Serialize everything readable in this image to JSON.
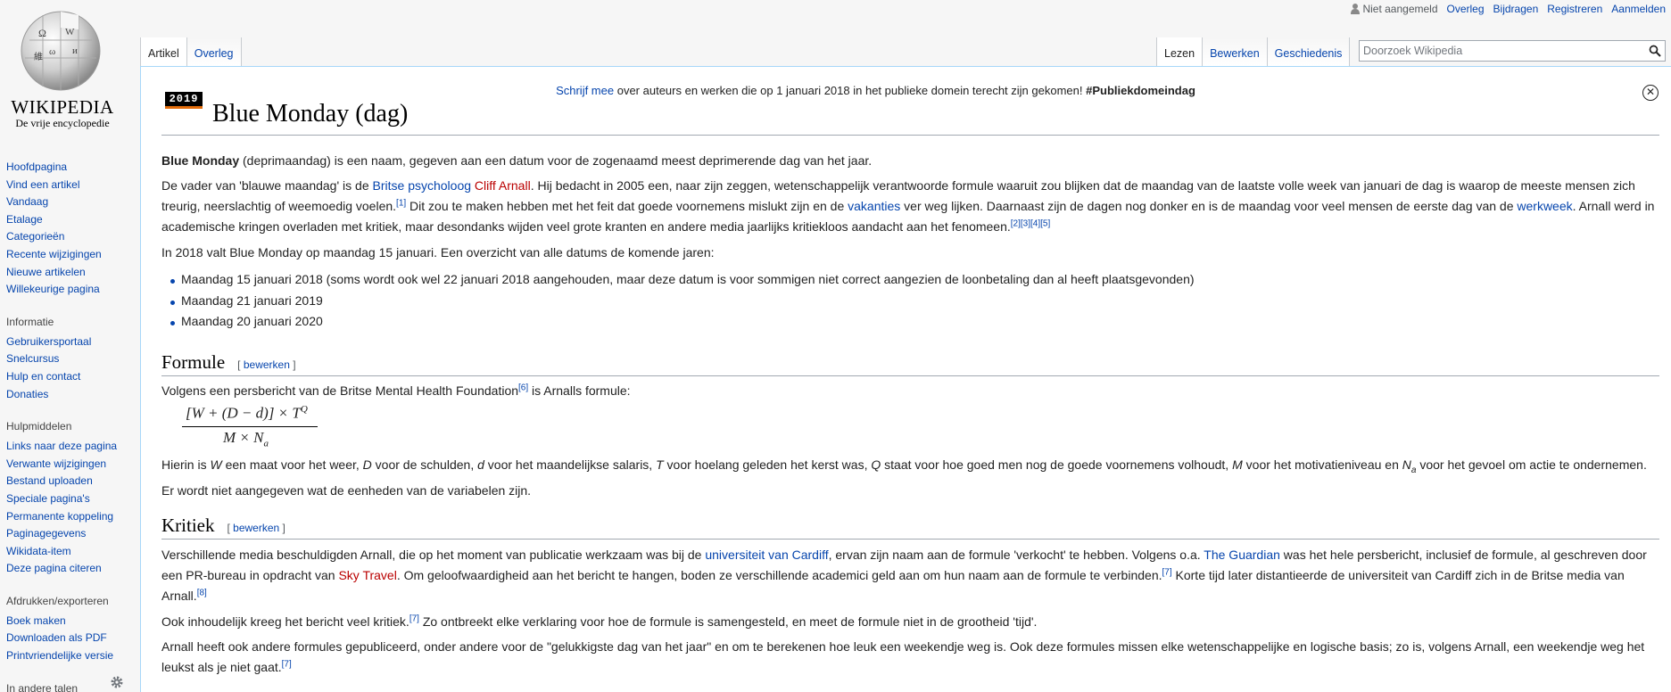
{
  "logo": {
    "wordmark": "Wikipedia",
    "tagline": "De vrije encyclopedie"
  },
  "personal": {
    "anon": "Niet aangemeld",
    "links": [
      "Overleg",
      "Bijdragen",
      "Registreren",
      "Aanmelden"
    ]
  },
  "tabs_left": [
    "Artikel",
    "Overleg"
  ],
  "tabs_right": [
    "Lezen",
    "Bewerken",
    "Geschiedenis"
  ],
  "search": {
    "placeholder": "Doorzoek Wikipedia"
  },
  "sidebar": {
    "nav": [
      "Hoofdpagina",
      "Vind een artikel",
      "Vandaag",
      "Etalage",
      "Categorieën",
      "Recente wijzigingen",
      "Nieuwe artikelen",
      "Willekeurige pagina"
    ],
    "info_heading": "Informatie",
    "info": [
      "Gebruikersportaal",
      "Snelcursus",
      "Hulp en contact",
      "Donaties"
    ],
    "tools_heading": "Hulpmiddelen",
    "tools": [
      "Links naar deze pagina",
      "Verwante wijzigingen",
      "Bestand uploaden",
      "Speciale pagina's",
      "Permanente koppeling",
      "Paginagegevens",
      "Wikidata-item",
      "Deze pagina citeren"
    ],
    "print_heading": "Afdrukken/exporteren",
    "print": [
      "Boek maken",
      "Downloaden als PDF",
      "Printvriendelijke versie"
    ],
    "lang_heading": "In andere talen"
  },
  "notice": {
    "link": "Schrijf mee",
    "text": " over auteurs en werken die op 1 januari 2018 in het publieke domein terecht zijn gekomen! ",
    "tag": "#Publiekdomeindag",
    "banner": "2019"
  },
  "article": {
    "title": "Blue Monday (dag)",
    "p1_bold": "Blue Monday",
    "p1_rest": " (deprimaandag) is een naam, gegeven aan een datum voor de zogenaamd meest deprimerende dag van het jaar.",
    "p2": {
      "a": "De vader van 'blauwe maandag' is de ",
      "l1": "Britse",
      "b": " ",
      "l2": "psycholoog",
      "c": " ",
      "l3": "Cliff Arnall",
      "d": ". Hij bedacht in 2005 een, naar zijn zeggen, wetenschappelijk verantwoorde formule waaruit zou blijken dat de maandag van de laatste volle week van januari de dag is waarop de meeste mensen zich treurig, neerslachtig of weemoedig voelen.",
      "r1": "[1]",
      "e": " Dit zou te maken hebben met het feit dat goede voornemens mislukt zijn en de ",
      "l4": "vakanties",
      "f": " ver weg lijken. Daarnaast zijn de dagen nog donker en is de maandag voor veel mensen de eerste dag van de ",
      "l5": "werkweek",
      "g": ". Arnall werd in academische kringen overladen met kritiek, maar desondanks wijden veel grote kranten en andere media jaarlijks kritiekloos aandacht aan het fenomeen.",
      "r2": "[2][3][4][5]"
    },
    "p3": "In 2018 valt Blue Monday op maandag 15 januari. Een overzicht van alle datums de komende jaren:",
    "days": [
      "Maandag 15 januari 2018 (soms wordt ook wel 22 januari 2018 aangehouden, maar deze datum is voor sommigen niet correct aangezien de loonbetaling dan al heeft plaatsgevonden)",
      "Maandag 21 januari 2019",
      "Maandag 20 januari 2020"
    ],
    "h_formule": "Formule",
    "edit_label": "[ bewerken ]",
    "f1": {
      "a": "Volgens een persbericht van de Britse Mental Health Foundation",
      "r": "[6]",
      "b": " is Arnalls formule:"
    },
    "formula": {
      "num": "[W + (D − d)] × T",
      "num_sup": "Q",
      "den": "M × N",
      "den_sub": "a"
    },
    "f2": {
      "a": "Hierin is ",
      "W": "W",
      "b": " een maat voor het weer, ",
      "D": "D",
      "c": " voor de schulden, ",
      "d": "d",
      "e": " voor het maandelijkse salaris, ",
      "T": "T",
      "f": " voor hoelang geleden het kerst was, ",
      "Q": "Q",
      "g": " staat voor hoe goed men nog de goede voornemens volhoudt, ",
      "M": "M",
      "h": " voor het motivatieniveau en ",
      "N": "N",
      "Nsub": "a",
      "i": " voor het gevoel om actie te ondernemen. Er wordt niet aangegeven wat de eenheden van de variabelen zijn."
    },
    "h_kritiek": "Kritiek",
    "k1": {
      "a": "Verschillende media beschuldigden Arnall, die op het moment van publicatie werkzaam was bij de ",
      "l1": "universiteit van Cardiff",
      "b": ", ervan zijn naam aan de formule 'verkocht' te hebben. Volgens o.a. ",
      "l2": "The Guardian",
      "c": " was het hele persbericht, inclusief de formule, al geschreven door een PR-bureau in opdracht van ",
      "l3": "Sky Travel",
      "d": ". Om geloofwaardigheid aan het bericht te hangen, boden ze verschillende academici geld aan om hun naam aan de formule te verbinden.",
      "r1": "[7]",
      "e": " Korte tijd later distantieerde de universiteit van Cardiff zich in de Britse media van Arnall.",
      "r2": "[8]"
    },
    "k2": {
      "a": "Ook inhoudelijk kreeg het bericht veel kritiek.",
      "r": "[7]",
      "b": " Zo ontbreekt elke verklaring voor hoe de formule is samengesteld, en meet de formule niet in de grootheid 'tijd'."
    },
    "k3": {
      "a": "Arnall heeft ook andere formules gepubliceerd, onder andere voor de \"gelukkigste dag van het jaar\" en om te berekenen hoe leuk een weekendje weg is. Ook deze formules missen elke wetenschappelijke en logische basis; zo is, volgens Arnall, een weekendje weg het leukst als je niet gaat.",
      "r": "[7]"
    }
  }
}
